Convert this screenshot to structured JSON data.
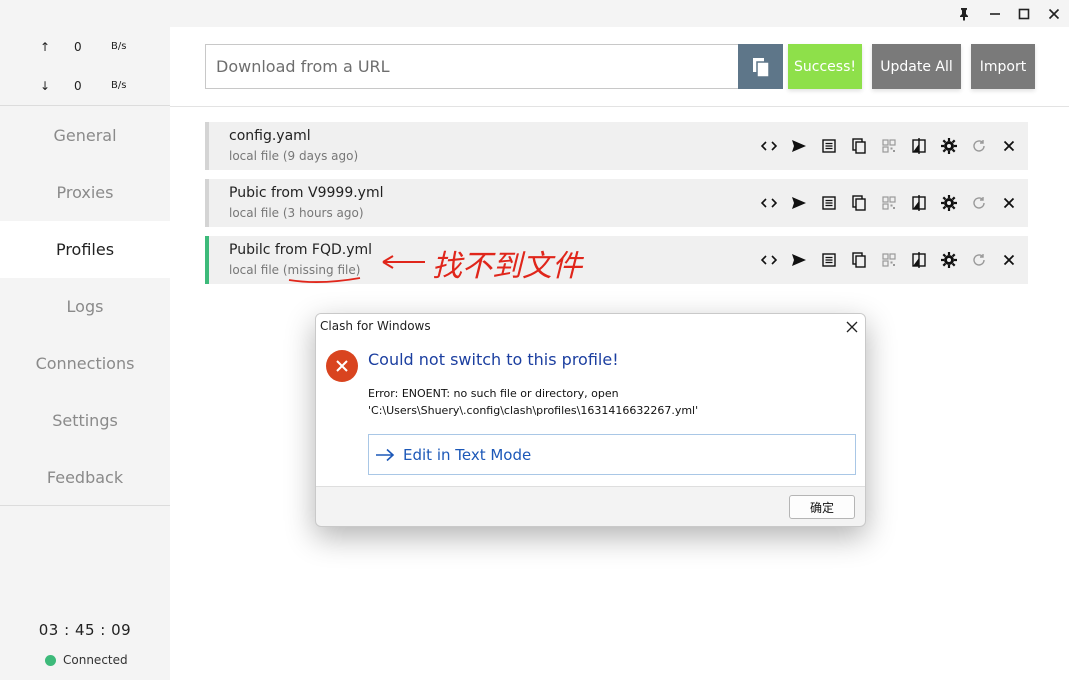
{
  "window": {
    "pin_icon": "pin-icon",
    "minimize_icon": "minimize-icon",
    "maximize_icon": "maximize-icon",
    "close_icon": "close-icon"
  },
  "traffic": {
    "up_arrow": "↑",
    "up_value": "0",
    "up_unit": "B/s",
    "down_arrow": "↓",
    "down_value": "0",
    "down_unit": "B/s"
  },
  "nav": {
    "items": [
      {
        "label": "General"
      },
      {
        "label": "Proxies"
      },
      {
        "label": "Profiles",
        "active": true
      },
      {
        "label": "Logs"
      },
      {
        "label": "Connections"
      },
      {
        "label": "Settings"
      },
      {
        "label": "Feedback"
      }
    ]
  },
  "status": {
    "time": "03 : 45 : 09",
    "connection": "Connected",
    "connected_color": "#3dba7a"
  },
  "toolbar": {
    "url_placeholder": "Download from a URL",
    "paste_icon": "paste-icon",
    "success_label": "Success!",
    "update_all_label": "Update All",
    "import_label": "Import",
    "success_color": "#8ee04a",
    "paste_color": "#5e7689"
  },
  "profiles": [
    {
      "name": "config.yaml",
      "desc": "local file (9 days ago)",
      "selected": false
    },
    {
      "name": "Pubic from V9999.yml",
      "desc": "local file (3 hours ago)",
      "selected": false
    },
    {
      "name": "Pubilc from FQD.yml",
      "desc": "local file (missing file)",
      "selected": true
    }
  ],
  "profile_icons": [
    "code-icon",
    "send-icon",
    "list-icon",
    "copy-icon",
    "qrcode-icon",
    "compare-icon",
    "gear-icon",
    "refresh-icon",
    "delete-icon"
  ],
  "annotation": {
    "text": "找不到文件",
    "color": "#e0261b"
  },
  "dialog": {
    "title": "Clash for Windows",
    "heading": "Could not switch to this profile!",
    "message_line1": "Error: ENOENT: no such file or directory, open",
    "message_line2": "'C:\\Users\\Shuery\\.config\\clash\\profiles\\1631416632267.yml'",
    "link_label": "Edit in Text Mode",
    "ok_label": "确定"
  }
}
